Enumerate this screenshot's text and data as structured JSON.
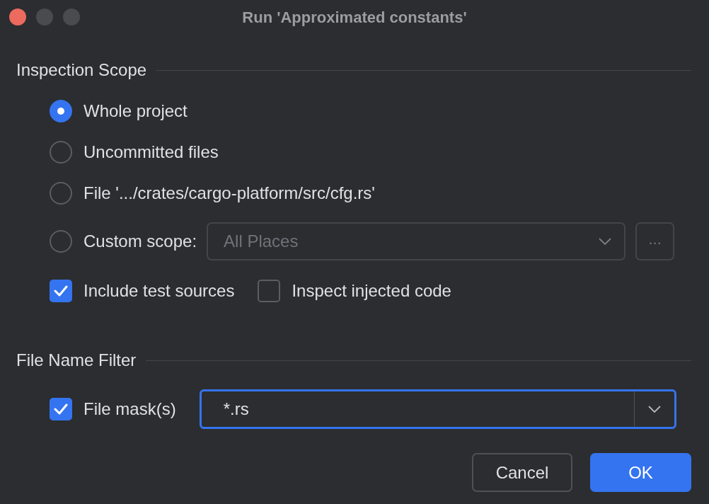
{
  "window": {
    "title": "Run 'Approximated constants'"
  },
  "inspection_scope": {
    "title": "Inspection Scope",
    "options": [
      {
        "label": "Whole project",
        "selected": true,
        "kind": "plain"
      },
      {
        "label": "Uncommitted files",
        "selected": false,
        "kind": "plain"
      },
      {
        "label": "File '.../crates/cargo-platform/src/cfg.rs'",
        "selected": false,
        "kind": "plain"
      },
      {
        "label": "Custom scope:",
        "selected": false,
        "kind": "scope"
      }
    ],
    "custom_scope": {
      "value": "All Places",
      "disabled": true
    },
    "more_button": "...",
    "checkboxes": [
      {
        "label": "Include test sources",
        "checked": true
      },
      {
        "label": "Inspect injected code",
        "checked": false
      }
    ]
  },
  "file_name_filter": {
    "title": "File Name Filter",
    "mask": {
      "label": "File mask(s)",
      "checked": true,
      "value": "*.rs"
    }
  },
  "buttons": [
    {
      "label": "Cancel",
      "kind": "secondary"
    },
    {
      "label": "OK",
      "kind": "primary"
    }
  ]
}
